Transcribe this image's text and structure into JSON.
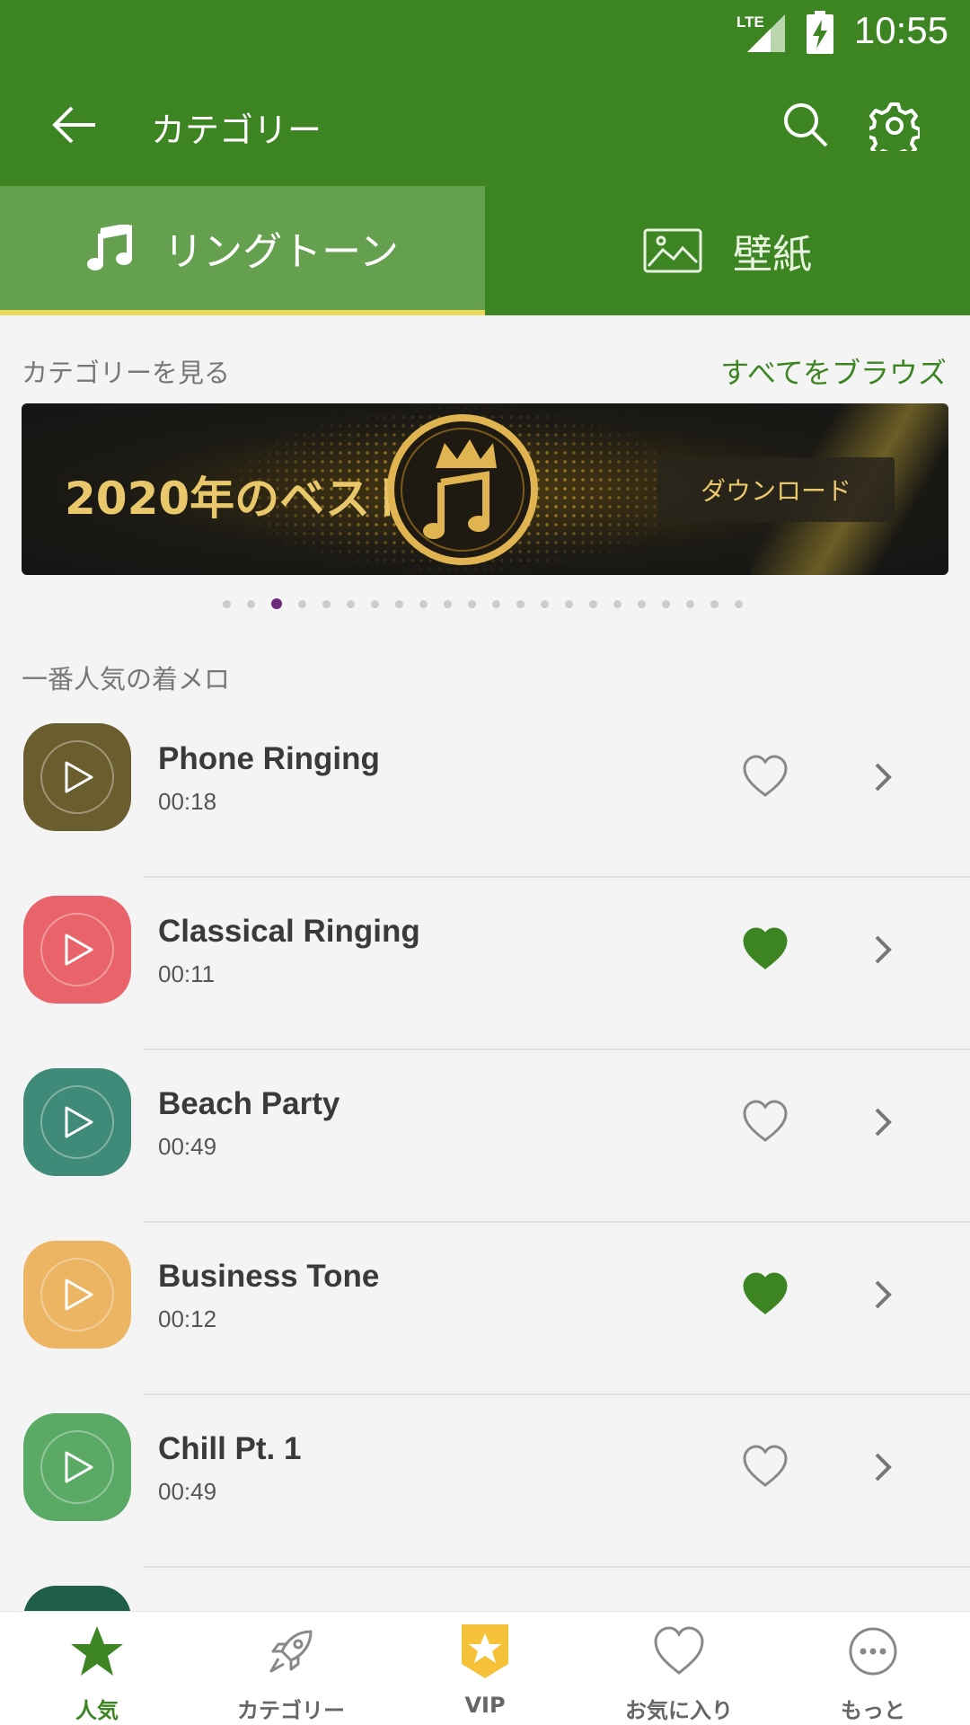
{
  "status_bar": {
    "network": "LTE",
    "time": "10:55"
  },
  "app_bar": {
    "title": "カテゴリー"
  },
  "tabs": [
    {
      "label": "リングトーン",
      "icon": "music-note-icon",
      "active": true
    },
    {
      "label": "壁紙",
      "icon": "image-icon",
      "active": false
    }
  ],
  "categories_section": {
    "header": "カテゴリーを見る",
    "browse_all": "すべてをブラウズ"
  },
  "banner": {
    "headline": "2020年のベスト",
    "button": "ダウンロード",
    "pager_count": 22,
    "pager_active_index": 2
  },
  "popular_section": {
    "header": "一番人気の着メロ"
  },
  "ringtones": [
    {
      "name": "Phone Ringing",
      "duration": "00:18",
      "color": "#6b5e2e",
      "favorite": false
    },
    {
      "name": "Classical Ringing",
      "duration": "00:11",
      "color": "#e8646a",
      "favorite": true
    },
    {
      "name": "Beach Party",
      "duration": "00:49",
      "color": "#3f8a78",
      "favorite": false
    },
    {
      "name": "Business Tone",
      "duration": "00:12",
      "color": "#ebb563",
      "favorite": true
    },
    {
      "name": "Chill Pt. 1",
      "duration": "00:49",
      "color": "#5aaa66",
      "favorite": false
    }
  ],
  "bottom_nav": [
    {
      "label": "人気",
      "icon": "star-icon",
      "active": true
    },
    {
      "label": "カテゴリー",
      "icon": "rocket-icon",
      "active": false
    },
    {
      "label": "VIP",
      "icon": "vip-badge-icon",
      "active": false
    },
    {
      "label": "お気に入り",
      "icon": "heart-icon",
      "active": false
    },
    {
      "label": "もっと",
      "icon": "more-icon",
      "active": false
    }
  ],
  "colors": {
    "primary": "#3d8523",
    "tab_active_bg": "#65a04f",
    "tab_indicator": "#e9d85a",
    "banner_gold": "#e9c86b",
    "pager_active": "#6b2a7a"
  }
}
